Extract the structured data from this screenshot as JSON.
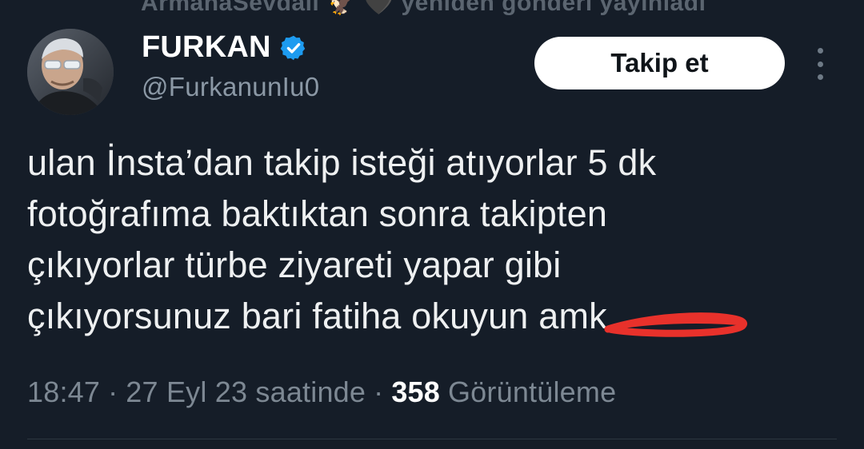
{
  "repost_banner": {
    "text": "ArmanaSevdalı 🦅 🖤 yeniden gönderi yayınladı"
  },
  "author": {
    "display_name": "FURKAN",
    "handle": "@FurkanunIu0",
    "verified": true,
    "verified_color": "#1d9bf0",
    "avatar_icon": "profile-photo"
  },
  "follow_button": {
    "label": "Takip et"
  },
  "more_icon": "more-vertical-icon",
  "tweet": {
    "lines": [
      "ulan İnsta’dan takip isteği atıyorlar 5 dk",
      "fotoğrafıma baktıktan sonra takipten",
      "çıkıyorlar türbe ziyareti yapar gibi",
      "çıkıyorsunuz bari fatiha okuyun"
    ],
    "scribbled_word": "amk",
    "scribble_color": "#e8312b"
  },
  "meta": {
    "time": "18:47",
    "date": "27 Eyl 23 saatinde",
    "views_count": "358",
    "views_label": "Görüntüleme",
    "separator": "·"
  },
  "colors": {
    "background": "#151d28",
    "text_primary": "#eef0f1",
    "text_secondary": "#8b98a5",
    "divider": "#2c3640"
  }
}
